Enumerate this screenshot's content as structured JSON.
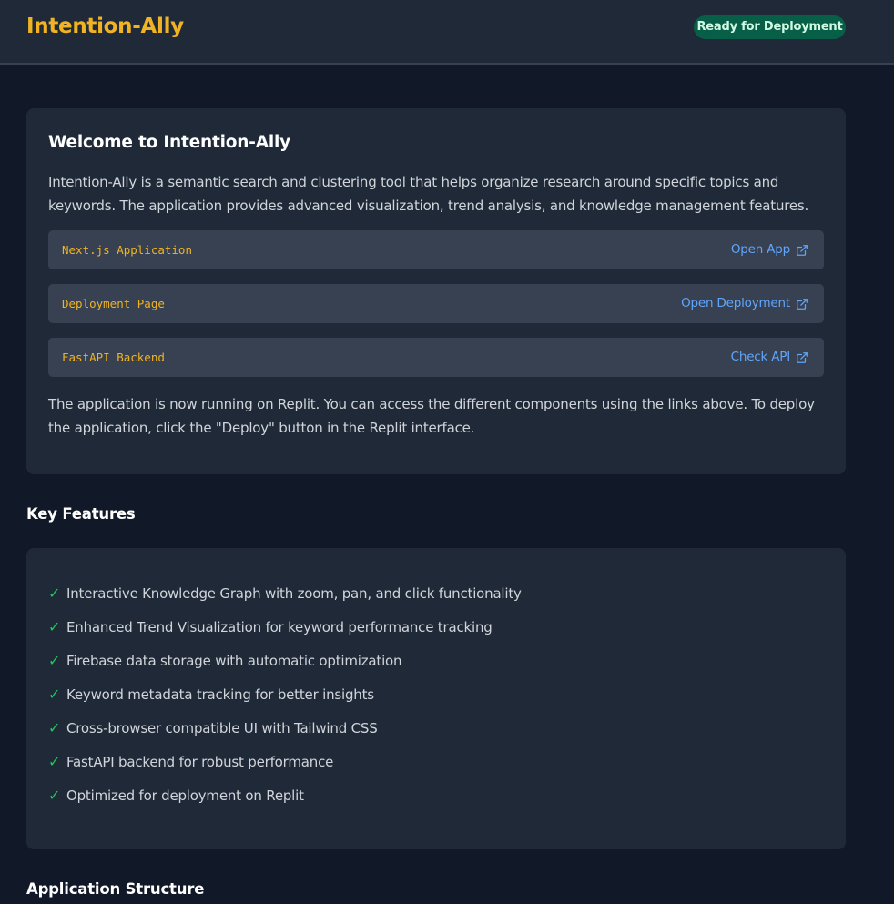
{
  "header": {
    "title": "Intention-Ally",
    "status_badge": "Ready for Deployment"
  },
  "welcome": {
    "title": "Welcome to Intention-Ally",
    "description": "Intention-Ally is a semantic search and clustering tool that helps organize research around specific topics and keywords. The application provides advanced visualization, trend analysis, and knowledge management features.",
    "links": [
      {
        "name": "Next.js Application",
        "action": "Open App"
      },
      {
        "name": "Deployment Page",
        "action": "Open Deployment"
      },
      {
        "name": "FastAPI Backend",
        "action": "Check API"
      }
    ],
    "footer": "The application is now running on Replit. You can access the different components using the links above. To deploy the application, click the \"Deploy\" button in the Replit interface."
  },
  "features": {
    "title": "Key Features",
    "check_symbol": "✓",
    "items": [
      "Interactive Knowledge Graph with zoom, pan, and click functionality",
      "Enhanced Trend Visualization for keyword performance tracking",
      "Firebase data storage with automatic optimization",
      "Keyword metadata tracking for better insights",
      "Cross-browser compatible UI with Tailwind CSS",
      "FastAPI backend for robust performance",
      "Optimized for deployment on Replit"
    ]
  },
  "structure": {
    "title": "Application Structure"
  },
  "colors": {
    "accent": "#f0b323",
    "link": "#60a5fa",
    "check": "#22c55e",
    "badge_bg": "#065f46",
    "background": "#111827",
    "card": "#1f2937"
  }
}
